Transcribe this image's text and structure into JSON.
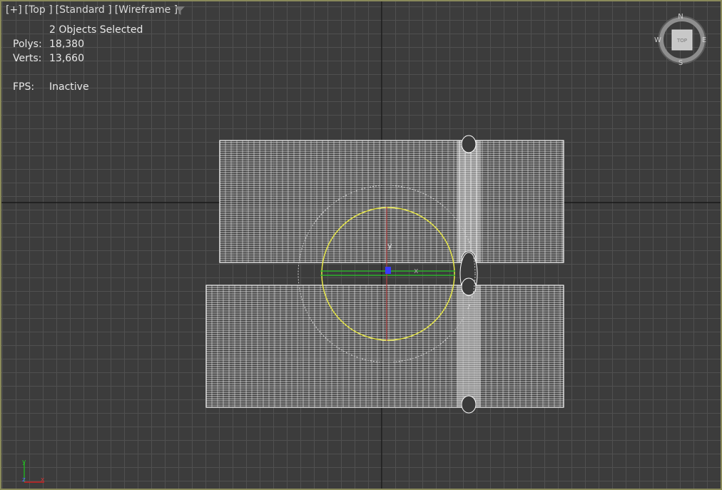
{
  "viewport": {
    "menu": [
      "[+]",
      "[Top ]",
      "[Standard ]",
      "[Wireframe ]"
    ],
    "filter_icon": "funnel-icon"
  },
  "stats": {
    "selection": "2 Objects Selected",
    "polys_label": "Polys:",
    "polys_value": "18,380",
    "verts_label": "Verts:",
    "verts_value": "13,660",
    "fps_label": "FPS:",
    "fps_value": "Inactive"
  },
  "viewcube": {
    "face": "TOP",
    "north": "N",
    "south": "S",
    "east": "E",
    "west": "W"
  },
  "gizmo": {
    "x_label": "x",
    "y_label": "y",
    "z_label": "z"
  },
  "colors": {
    "grid": "#505050",
    "wire": "#ffffff",
    "gizmo_circle": "#e8e84a",
    "axis_x": "#cc2222",
    "axis_y": "#22aa22",
    "axis_z": "#3a3aff"
  }
}
